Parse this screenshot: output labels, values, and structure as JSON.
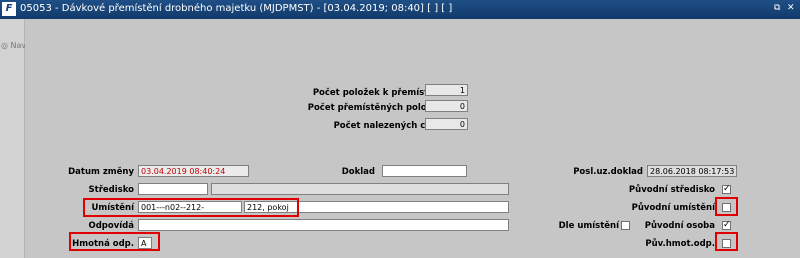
{
  "window": {
    "logo": "F",
    "title": "05053 - Dávkové přemístění drobného majetku (MJDPMST) - [03.04.2019; 08:40]  [ ] [ ]",
    "restore_glyph": "⧉",
    "close_glyph": "✕"
  },
  "sidebar": {
    "nav_label": "Nav",
    "nav_icon": "circle-icon"
  },
  "summary": {
    "count_items_label": "Počet položek k přemístění",
    "count_items_value": "1",
    "count_moved_label": "Počet přemístěných položek",
    "count_moved_value": "0",
    "count_errors_label": "Počet nalezených chyb",
    "count_errors_value": "0"
  },
  "form": {
    "datum_zmeny_label": "Datum změny",
    "datum_zmeny_value": "03.04.2019 08:40:24",
    "doklad_label": "Doklad",
    "doklad_value": "",
    "posl_uz_doklad_label": "Posl.uz.doklad",
    "posl_uz_doklad_value": "28.06.2018 08:17:53",
    "stredisko_label": "Středisko",
    "stredisko_value": "",
    "stredisko_name": "",
    "puvodni_stredisko_label": "Původní středisko",
    "puvodni_stredisko_checked": "✓",
    "umisteni_label": "Umístění",
    "umisteni_code": "001---n02--212-",
    "umisteni_name": "212, pokoj",
    "puvodni_umisteni_label": "Původní umístění",
    "puvodni_umisteni_checked": "",
    "odpovida_label": "Odpovídá",
    "odpovida_value": "",
    "dle_umisteni_label": "Dle umístění",
    "dle_umisteni_checked": "",
    "puvodni_osoba_label": "Původní osoba",
    "puvodni_osoba_checked": "✓",
    "hmotna_odp_label": "Hmotná odp.",
    "hmotna_odp_value": "A",
    "puv_hmot_odp_label": "Pův.hmot.odp.",
    "puv_hmot_odp_checked": ""
  },
  "colors": {
    "highlight": "#e00000",
    "titlebar": "#1a4680",
    "date_text": "#c00000"
  }
}
